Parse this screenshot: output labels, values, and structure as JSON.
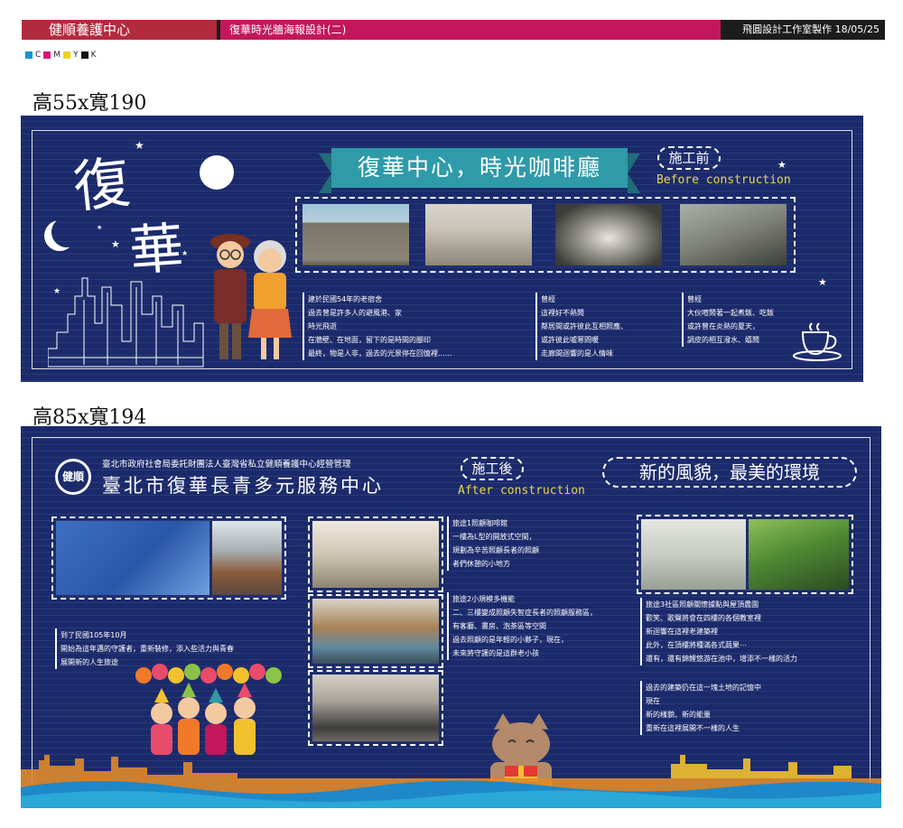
{
  "header": {
    "left_title": "健順養護中心",
    "mid_title": "復華時光牆海報設計(二)",
    "right_credit": "飛圓設計工作室製作 18/05/25"
  },
  "cmyk": {
    "c": "C",
    "m": "M",
    "y": "Y",
    "k": "K",
    "colors": {
      "c": "#1a8fd6",
      "m": "#d6157a",
      "y": "#f2d21e",
      "k": "#111111"
    }
  },
  "poster1": {
    "size_label": "高55x寬190",
    "title_char1": "復",
    "title_char2": "華",
    "banner": "復華中心，時光咖啡廳",
    "tag": "施工前",
    "tag_en": "Before construction",
    "text1": "建於民國54年的老宿舍\n過去曾是許多人的避風港、家\n時光飛逝\n在牆壁、在地面，留下的是時間的腳印\n最終，物是人非，過去的光景停在回憶裡......",
    "text2": "曾經\n這裡好不熱鬧\n鄰居間或許彼此互相照應、\n或許彼此噓寒問暖\n走廊間迴響的是人情味",
    "text3": "曾經\n大伙喧鬧著一起煮飯、吃飯\n或許曾在炎熱的夏天，\n調皮的相互潑水、嬉鬧"
  },
  "poster2": {
    "size_label": "高85x寬194",
    "logo": "健順",
    "subtitle": "臺北市政府社會局委託財團法人臺灣省私立健順養護中心經營管理",
    "title": "臺北市復華長青多元服務中心",
    "tag": "施工後",
    "tag_en": "After construction",
    "slogan": "新的風貌，最美的環境",
    "text1": "到了民國105年10月\n開始為這年邁的守護者，重新裝修，添入些活力與青春\n展開新的人生旅途",
    "text2": "旅途1照顧咖啡館\n一樓為L型的開放式空間，\n規劃為辛苦照顧長者的照顧\n者們休憩的小地方",
    "text3": "旅途2小規模多機能\n二、三樓變成照顧失智症長者的照顧服務區，\n有客廳、書房、泡茶區等空間\n過去照顧的是年輕的小夥子，現在，\n未來將守護的是這群老小孩",
    "text4": "旅途3社區照顧關懷據點與屋頂農園\n歡笑、歌聲將會在四樓的各個教室裡\n新迴響在這裡老建築裡\n此外，在頂樓將種滿各式蔬果⋯\n還有，還有錦鯉悠游在池中，增添不一樣的活力",
    "text5": "過去的建築仍在這一塊土地的記憶中\n現在\n新的樣貌、新的能量\n重新在這裡展開不一樣的人生"
  }
}
